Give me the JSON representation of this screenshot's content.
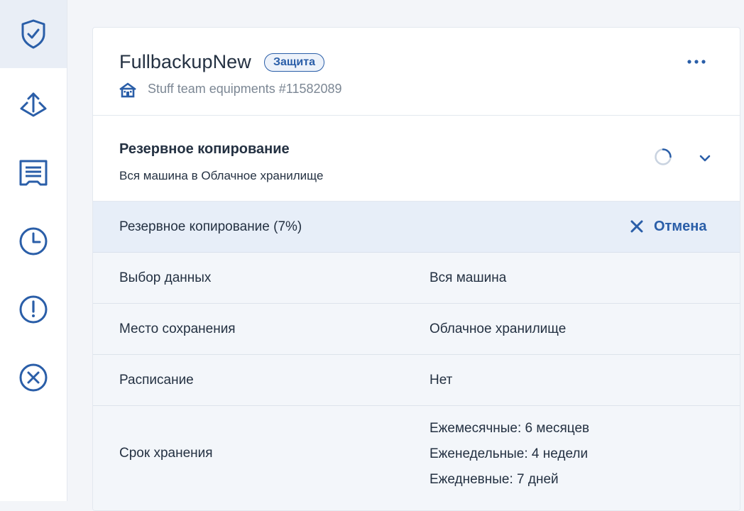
{
  "sidebar": {
    "items": [
      {
        "name": "shield-check-icon",
        "active": true
      },
      {
        "name": "backup-upload-icon",
        "active": false
      },
      {
        "name": "report-icon",
        "active": false
      },
      {
        "name": "clock-icon",
        "active": false
      },
      {
        "name": "alert-icon",
        "active": false
      },
      {
        "name": "close-circle-icon",
        "active": false
      }
    ]
  },
  "header": {
    "title": "FullbackupNew",
    "badge": "Защита",
    "subtitle": "Stuff team equipments #11582089",
    "more_icon": "more-horizontal-icon"
  },
  "plan": {
    "title": "Резервное копирование",
    "subtitle": "Вся машина в Облачное хранилище"
  },
  "progress": {
    "label": "Резервное копирование (7%)",
    "percent": 7,
    "cancel_label": "Отмена"
  },
  "details": [
    {
      "label": "Выбор данных",
      "value": "Вся машина"
    },
    {
      "label": "Место сохранения",
      "value": "Облачное хранилище"
    },
    {
      "label": "Расписание",
      "value": "Нет"
    },
    {
      "label": "Срок хранения",
      "values": [
        "Ежемесячные: 6 месяцев",
        "Еженедельные: 4 недели",
        "Ежедневные: 7 дней"
      ]
    }
  ],
  "colors": {
    "accent": "#2a5ea8",
    "text": "#243142",
    "muted": "#7c8794",
    "progress_bg": "#e7eef8"
  }
}
